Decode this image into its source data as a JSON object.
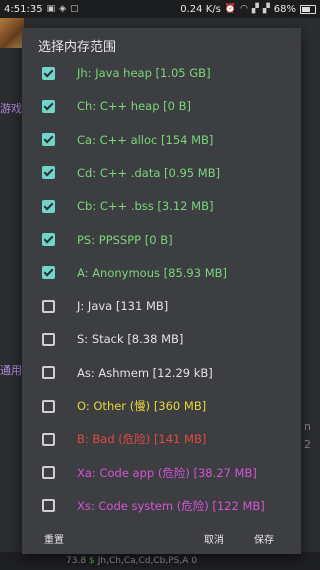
{
  "status_bar": {
    "time": "4:51:35",
    "net_speed": "0.24 K/s",
    "battery_percent": "68%"
  },
  "background": {
    "left_fragments": [
      "游戏",
      "通用"
    ],
    "right_fragments": [
      "n",
      "2"
    ],
    "bottom_bar": {
      "size_text": "73.8",
      "dollar": "$",
      "regions_text": "Jh,Ch,Ca,Cd,Cb,PS,A",
      "count": "0"
    }
  },
  "dialog": {
    "title": "选择内存范围",
    "options": [
      {
        "label": "Jh: Java heap [1.05 GB]",
        "checked": true,
        "color": "#7ad77a"
      },
      {
        "label": "Ch: C++ heap [0 B]",
        "checked": true,
        "color": "#7ad77a"
      },
      {
        "label": "Ca: C++ alloc [154 MB]",
        "checked": true,
        "color": "#7ad77a"
      },
      {
        "label": "Cd: C++ .data [0.95 MB]",
        "checked": true,
        "color": "#7ad77a"
      },
      {
        "label": "Cb: C++ .bss [3.12 MB]",
        "checked": true,
        "color": "#7ad77a"
      },
      {
        "label": "PS: PPSSPP [0 B]",
        "checked": true,
        "color": "#7ad77a"
      },
      {
        "label": "A: Anonymous [85.93 MB]",
        "checked": true,
        "color": "#7ad77a"
      },
      {
        "label": "J: Java [131 MB]",
        "checked": false,
        "color": "#e2e2e2"
      },
      {
        "label": "S: Stack [8.38 MB]",
        "checked": false,
        "color": "#e2e2e2"
      },
      {
        "label": "As: Ashmem [12.29 kB]",
        "checked": false,
        "color": "#e2e2e2"
      },
      {
        "label": "O: Other (慢) [360 MB]",
        "checked": false,
        "color": "#e8d73a"
      },
      {
        "label": "B: Bad (危险) [141 MB]",
        "checked": false,
        "color": "#e24a3f"
      },
      {
        "label": "Xa: Code app (危险) [38.27 MB]",
        "checked": false,
        "color": "#d654d6"
      },
      {
        "label": "Xs: Code system (危险) [122 MB]",
        "checked": false,
        "color": "#d654d6"
      }
    ],
    "buttons": {
      "reset": "重置",
      "cancel": "取消",
      "save": "保存"
    }
  }
}
